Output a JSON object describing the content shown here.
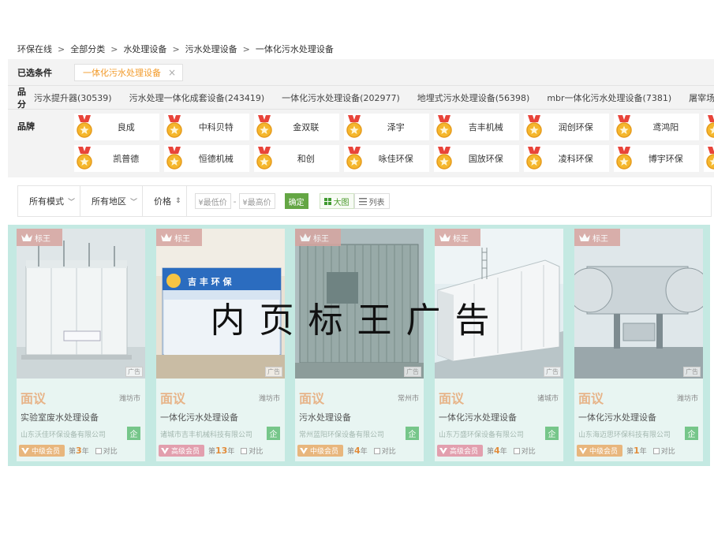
{
  "breadcrumb": [
    "环保在线",
    "全部分类",
    "水处理设备",
    "污水处理设备",
    "一体化污水处理设备"
  ],
  "filters": {
    "selected_label": "已选条件",
    "selected_chip": "一体化污水处理设备",
    "selected_chip_close": "×",
    "category_label": "产品分类",
    "categories": [
      "污水提升器(30539)",
      "污水处理一体化成套设备(243419)",
      "一体化污水处理设备(202977)",
      "地埋式污水处理设备(56398)",
      "mbr一体化污水处理设备(7381)",
      "屠宰场"
    ],
    "brand_label": "品牌",
    "brands": [
      "良成",
      "中科贝特",
      "金双联",
      "泽宇",
      "吉丰机械",
      "润创环保",
      "鸢鸿阳",
      "",
      "凯普德",
      "恒德机械",
      "和创",
      "咏佳环保",
      "国放环保",
      "凌科环保",
      "博宇环保",
      ""
    ]
  },
  "toolbar": {
    "mode": "所有模式",
    "region": "所有地区",
    "price": "价格",
    "price_sort_icon": "⇕",
    "min_price_placeholder": "¥最低价",
    "max_price_placeholder": "¥最高价",
    "dash": "-",
    "confirm": "确定",
    "view_grid": "大图",
    "view_list": "列表"
  },
  "badge_label": "标王",
  "ad_tag": "广告",
  "qi_label": "企",
  "compare_label": "对比",
  "products": [
    {
      "price": "面议",
      "city": "潍坊市",
      "name": "实验室废水处理设备",
      "company": "山东沃佳环保设备有限公司",
      "member": "中级会员",
      "member_style": "gold",
      "years_pre": "第",
      "years": "3",
      "years_post": "年"
    },
    {
      "price": "面议",
      "city": "潍坊市",
      "name": "一体化污水处理设备",
      "company": "诸城市吉丰机械科技有限公司",
      "member": "高级会员",
      "member_style": "pink",
      "years_pre": "第",
      "years": "13",
      "years_post": "年"
    },
    {
      "price": "面议",
      "city": "常州市",
      "name": "污水处理设备",
      "company": "常州蓝阳环保设备有限公司",
      "member": "中级会员",
      "member_style": "gold",
      "years_pre": "第",
      "years": "4",
      "years_post": "年"
    },
    {
      "price": "面议",
      "city": "诸城市",
      "name": "一体化污水处理设备",
      "company": "山东万盛环保设备有限公司",
      "member": "高级会员",
      "member_style": "pink",
      "years_pre": "第",
      "years": "4",
      "years_post": "年"
    },
    {
      "price": "面议",
      "city": "潍坊市",
      "name": "一体化污水处理设备",
      "company": "山东海迈思环保科技有限公司",
      "member": "中级会员",
      "member_style": "gold",
      "years_pre": "第",
      "years": "1",
      "years_post": "年"
    }
  ],
  "photo_texts": {
    "card2_sign": "吉 丰 环 保"
  },
  "overlay": "内页标王广告",
  "colors": {
    "accent_green": "#64a644",
    "price_orange": "#e7b489",
    "ad_bg": "#c4e9e2",
    "chip_orange": "#f29b2b"
  }
}
